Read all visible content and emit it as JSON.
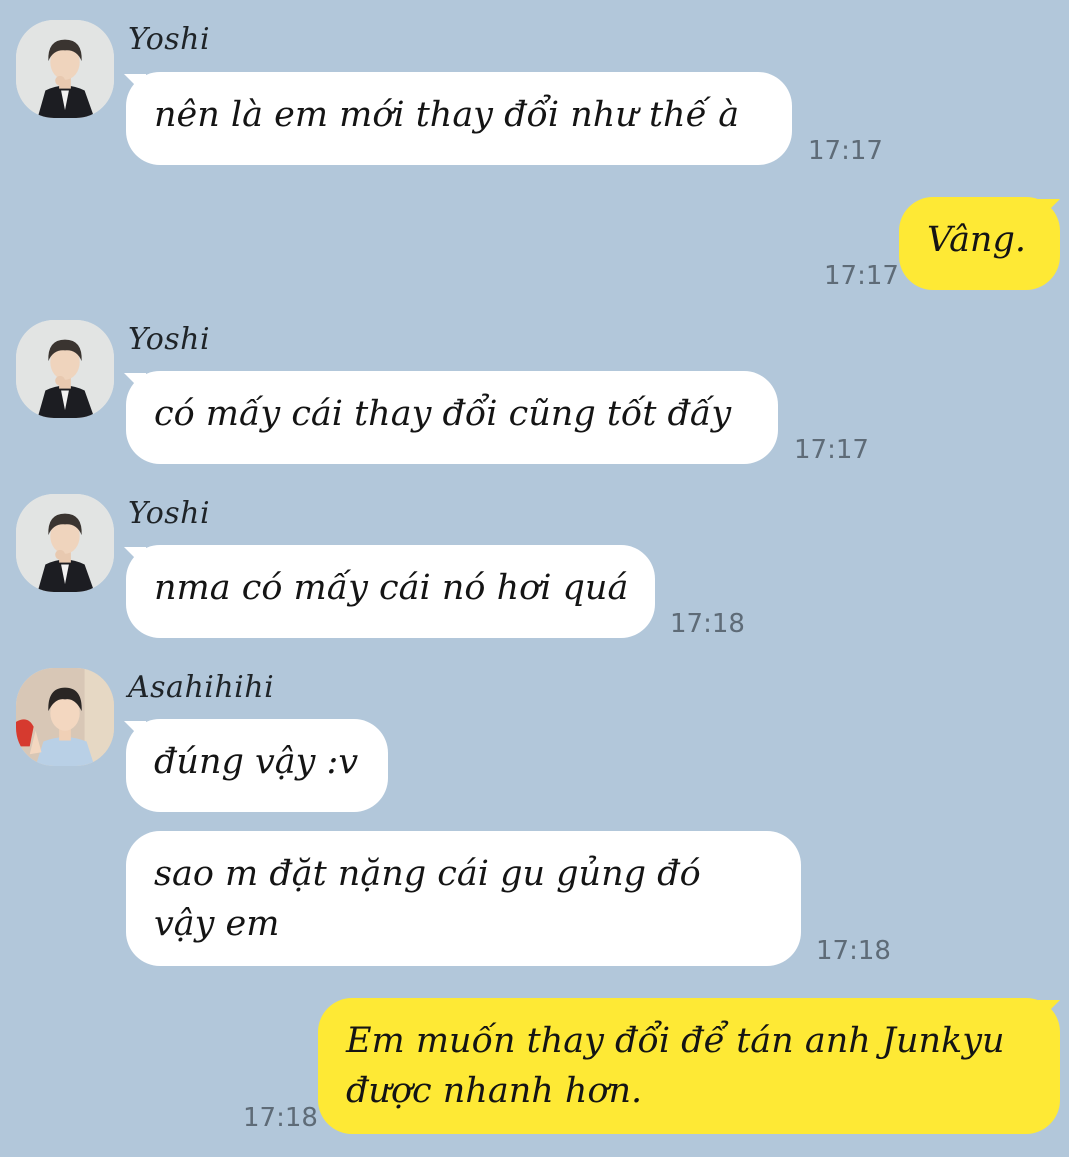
{
  "messages": [
    {
      "sender": "Yoshi",
      "text": "nên là em mới thay đổi như thế à",
      "time": "17:17"
    },
    {
      "sender": "me",
      "text": "Vâng.",
      "time": "17:17"
    },
    {
      "sender": "Yoshi",
      "text": "có mấy cái thay đổi cũng tốt đấy",
      "time": "17:17"
    },
    {
      "sender": "Yoshi",
      "text": "nma có mấy cái nó hơi quá",
      "time": "17:18"
    },
    {
      "sender": "Asahihihi",
      "text": "đúng vậy :v"
    },
    {
      "sender": "Asahihihi",
      "line1": "sao m đặt nặng cái gu gủng đó",
      "line2": "vậy em",
      "time": "17:18"
    },
    {
      "sender": "me",
      "line1": "Em muốn thay đổi để tán anh Junkyu",
      "line2": "được nhanh hơn.",
      "time": "17:18"
    }
  ],
  "colors": {
    "background": "#b2c7da",
    "incoming_bubble": "#ffffff",
    "outgoing_bubble": "#fee935",
    "timestamp": "#5e6b77"
  },
  "icons": {
    "yoshi_avatar": "profile-photo",
    "asahi_avatar": "profile-photo"
  }
}
